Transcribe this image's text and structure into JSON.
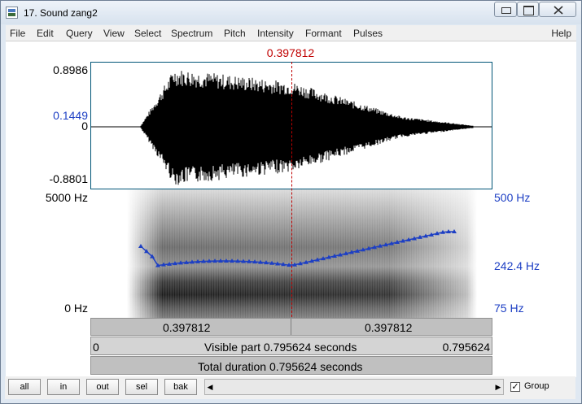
{
  "window": {
    "title": "17. Sound zang2"
  },
  "menu": [
    "File",
    "Edit",
    "Query",
    "View",
    "Select",
    "Spectrum",
    "Pitch",
    "Intensity",
    "Formant",
    "Pulses"
  ],
  "menu_help": "Help",
  "cursor": {
    "time_label": "0.397812",
    "time": 0.397812
  },
  "waveform": {
    "y_max": "0.8986",
    "y_cursor": "0.1449",
    "y_zero": "0",
    "y_min": "-0.8801"
  },
  "spectrogram": {
    "freq_max": "5000 Hz",
    "freq_min": "0 Hz",
    "pitch_max": "500 Hz",
    "pitch_cursor": "242.4 Hz",
    "pitch_min": "75 Hz"
  },
  "time_bar": {
    "left": "0.397812",
    "right": "0.397812"
  },
  "visible_bar": {
    "start": "0",
    "label": "Visible part 0.795624 seconds",
    "end": "0.795624"
  },
  "total_bar": {
    "label": "Total duration 0.795624 seconds"
  },
  "buttons": {
    "all": "all",
    "in": "in",
    "out": "out",
    "sel": "sel",
    "bak": "bak"
  },
  "group": {
    "label": "Group",
    "checked": true,
    "check_mark": "✓"
  },
  "scroll": {
    "left_arrow": "◀",
    "right_arrow": "▶"
  },
  "colors": {
    "cursor": "#c00000",
    "pitch": "#1d3fc4"
  }
}
